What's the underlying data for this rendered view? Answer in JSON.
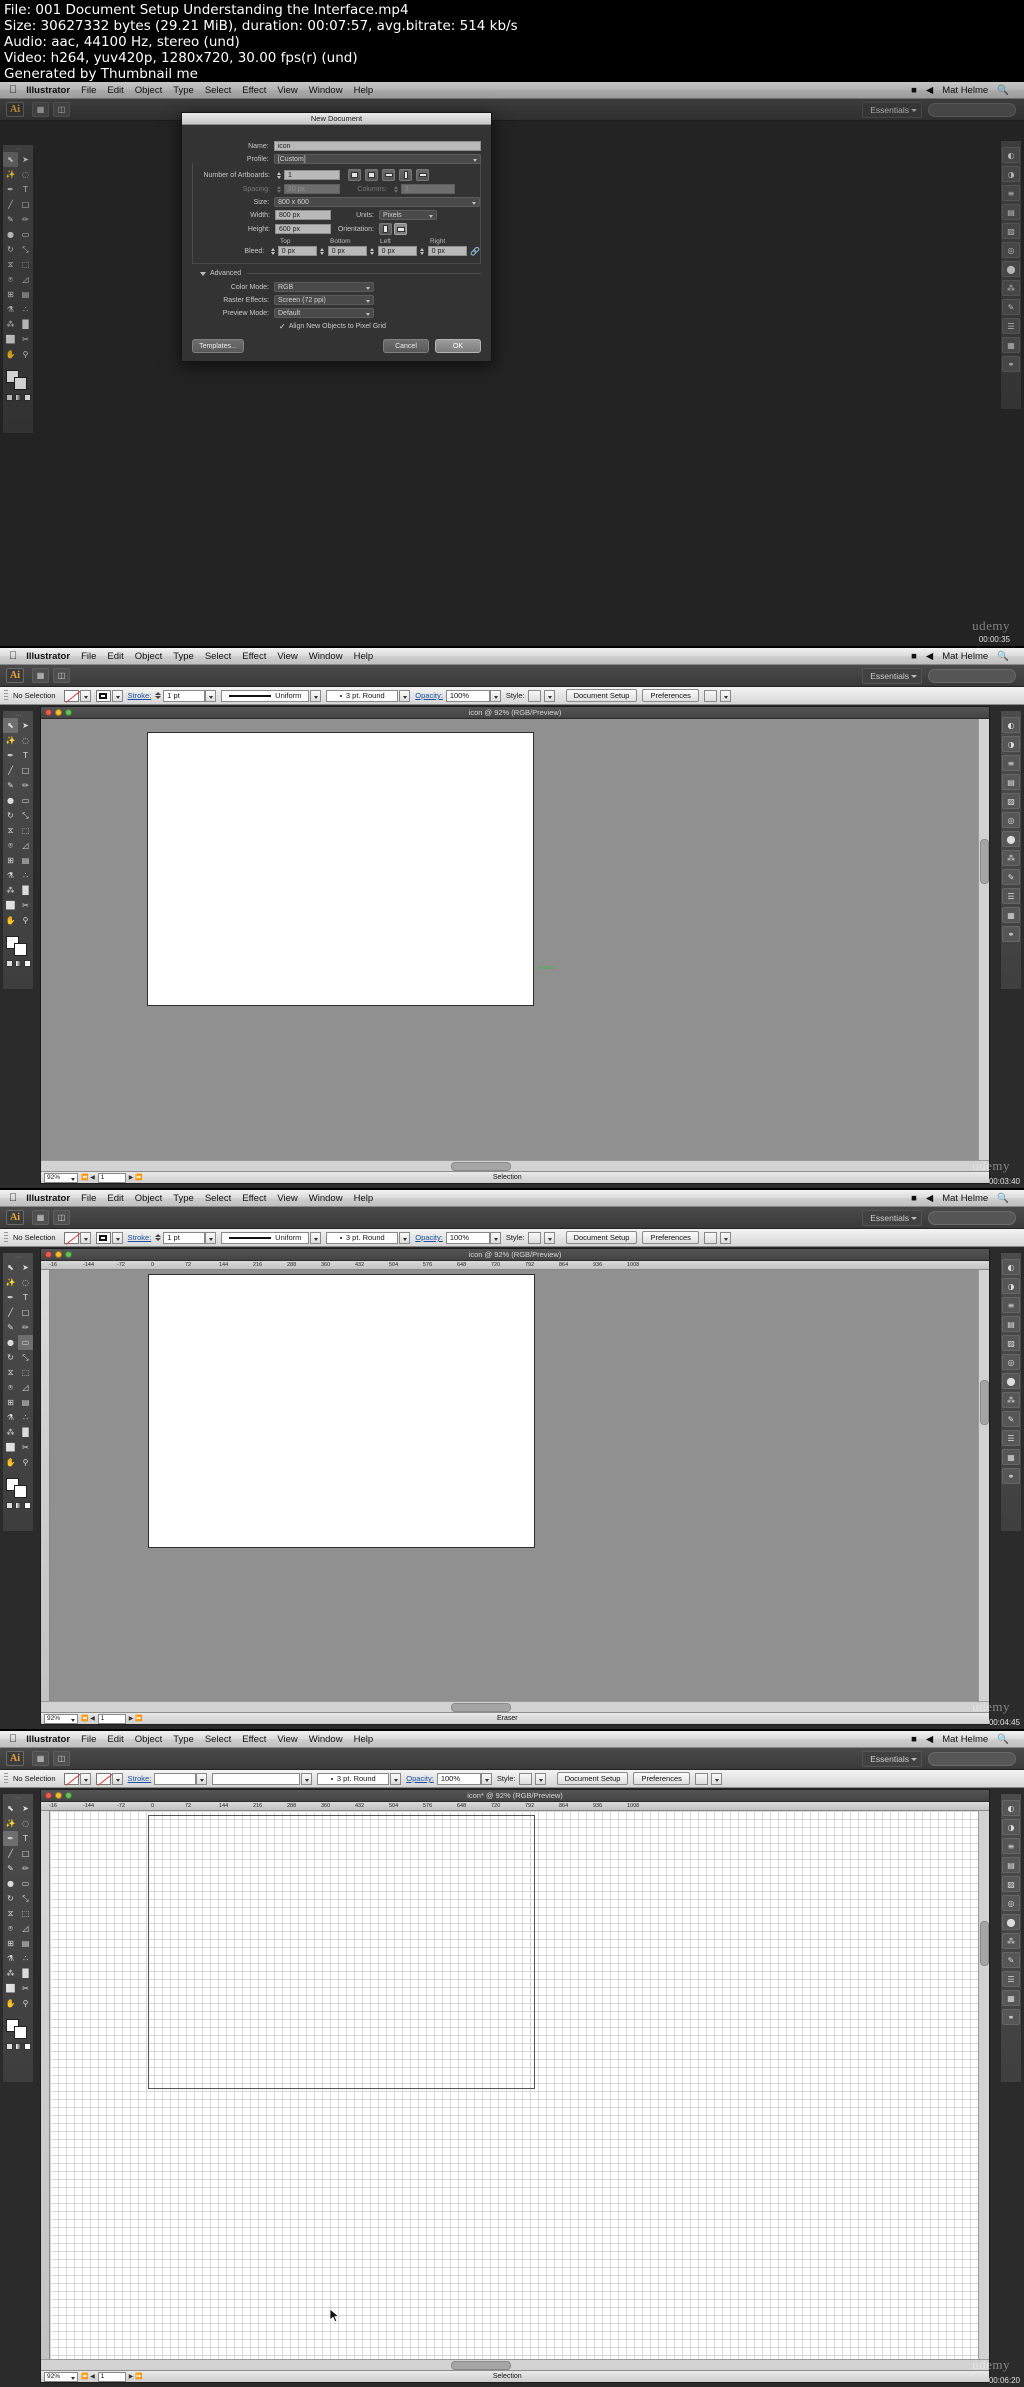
{
  "meta": {
    "line1": "File: 001 Document Setup  Understanding the Interface.mp4",
    "line2": "Size: 30627332 bytes (29.21 MiB), duration: 00:07:57, avg.bitrate: 514 kb/s",
    "line3": "Audio: aac, 44100 Hz, stereo (und)",
    "line4": "Video: h264, yuv420p, 1280x720, 30.00 fps(r) (und)",
    "line5": "Generated by Thumbnail me"
  },
  "macbar": {
    "apple": "apple-icon",
    "items": [
      "Illustrator",
      "File",
      "Edit",
      "Object",
      "Type",
      "Select",
      "Effect",
      "View",
      "Window",
      "Help"
    ],
    "right": [
      "Mat Helme"
    ],
    "search_icon": "search-icon",
    "battery_icon": "battery-icon",
    "volume_icon": "volume-icon"
  },
  "appbar": {
    "logo": "Ai",
    "workspace": "Essentials",
    "search_placeholder": ""
  },
  "control_bar": {
    "selection": "No Selection",
    "stroke_label": "Stroke:",
    "stroke_value": "1 pt",
    "profile_value": "Uniform",
    "brush_value": "3 pt. Round",
    "opacity_label": "Opacity:",
    "opacity_value": "100%",
    "style_label": "Style:",
    "doc_setup": "Document Setup",
    "preferences": "Preferences"
  },
  "dialog": {
    "title": "New Document",
    "name_label": "Name:",
    "name_value": "icon",
    "profile_label": "Profile:",
    "profile_value": "[Custom]",
    "artboards_label": "Number of Artboards:",
    "artboards_value": "1",
    "spacing_label": "Spacing:",
    "spacing_value": "20 px",
    "columns_label": "Columns:",
    "columns_value": "1",
    "size_label": "Size:",
    "size_value": "800 x 600",
    "width_label": "Width:",
    "width_value": "800 px",
    "units_label": "Units:",
    "units_value": "Pixels",
    "height_label": "Height:",
    "height_value": "600 px",
    "orientation_label": "Orientation:",
    "bleed_label": "Bleed:",
    "bleed_top_header": "Top",
    "bleed_bottom_header": "Bottom",
    "bleed_left_header": "Left",
    "bleed_right_header": "Right",
    "bleed_top": "0 px",
    "bleed_bottom": "0 px",
    "bleed_left": "0 px",
    "bleed_right": "0 px",
    "advanced_label": "Advanced",
    "color_mode_label": "Color Mode:",
    "color_mode_value": "RGB",
    "raster_label": "Raster Effects:",
    "raster_value": "Screen (72 ppi)",
    "preview_label": "Preview Mode:",
    "preview_value": "Default",
    "align_checkbox": "Align New Objects to Pixel Grid",
    "templates_button": "Templates...",
    "cancel_button": "Cancel",
    "ok_button": "OK"
  },
  "shots": [
    {
      "id": "shot-1",
      "doc_title": "",
      "status_mode": "",
      "timestamp": "00:00:35",
      "watermark": "udemy",
      "zoom": ""
    },
    {
      "id": "shot-2",
      "doc_title": "icon @ 92% (RGB/Preview)",
      "status_mode": "Selection",
      "zoom": "92%",
      "page": "1",
      "timestamp": "00:03:40",
      "watermark": "udemy"
    },
    {
      "id": "shot-3",
      "doc_title": "icon @ 92% (RGB/Preview)",
      "status_mode": "Eraser",
      "zoom": "92%",
      "page": "1",
      "timestamp": "00:04:45",
      "watermark": "udemy"
    },
    {
      "id": "shot-4",
      "doc_title": "icon* @ 92% (RGB/Preview)",
      "status_mode": "Selection",
      "zoom": "92%",
      "page": "1",
      "timestamp": "00:06:20",
      "watermark": "udemy"
    }
  ],
  "ruler_ticks": [
    "-16",
    "-144",
    "-72",
    "0",
    "72",
    "144",
    "216",
    "288",
    "360",
    "432",
    "504",
    "576",
    "648",
    "720",
    "792",
    "864",
    "936",
    "1008"
  ],
  "toolbar_tools": [
    "selection-tool",
    "direct-selection-tool",
    "magic-wand-tool",
    "lasso-tool",
    "pen-tool",
    "type-tool",
    "line-segment-tool",
    "rectangle-tool",
    "paintbrush-tool",
    "pencil-tool",
    "blob-brush-tool",
    "eraser-tool",
    "rotate-tool",
    "scale-tool",
    "width-tool",
    "free-transform-tool",
    "shape-builder-tool",
    "perspective-grid-tool",
    "mesh-tool",
    "gradient-tool",
    "eyedropper-tool",
    "blend-tool",
    "symbol-sprayer-tool",
    "column-graph-tool",
    "artboard-tool",
    "slice-tool",
    "hand-tool",
    "zoom-tool"
  ],
  "dock_panels": [
    "color-panel",
    "color-guide-panel",
    "stroke-panel",
    "gradient-panel",
    "transparency-panel",
    "appearance-panel",
    "graphic-styles-panel",
    "symbols-panel",
    "brushes-panel",
    "layers-panel",
    "artboards-panel",
    "links-panel"
  ],
  "colors": {
    "app_bg": "#2b2b2b",
    "panel_bg": "#3e3e3e",
    "canvas": "#909090",
    "artboard": "#ffffff",
    "accent_orange": "#e8a33d",
    "link_blue": "#1b4fa0"
  }
}
